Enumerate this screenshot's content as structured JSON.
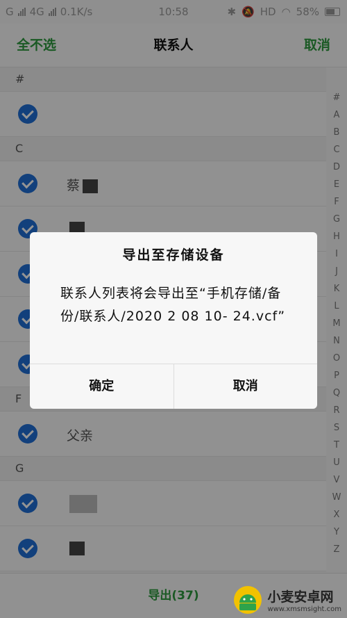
{
  "status_bar": {
    "carrier": "G",
    "network": "4G",
    "speed": "0.1K/s",
    "time": "10:58",
    "hd": "HD",
    "battery": "58%"
  },
  "app_bar": {
    "select_none": "全不选",
    "title": "联系人",
    "cancel": "取消"
  },
  "contacts": {
    "sections": [
      {
        "letter": "#",
        "rows": [
          {
            "name": ""
          }
        ]
      },
      {
        "letter": "C",
        "rows": [
          {
            "name": "蔡"
          },
          {
            "name": ""
          },
          {
            "name": ""
          },
          {
            "name": ""
          },
          {
            "name": ""
          }
        ]
      },
      {
        "letter": "F",
        "rows": [
          {
            "name": "父亲"
          }
        ]
      },
      {
        "letter": "G",
        "rows": [
          {
            "name": ""
          },
          {
            "name": ""
          }
        ]
      }
    ]
  },
  "alphabet_index": [
    "#",
    "A",
    "B",
    "C",
    "D",
    "E",
    "F",
    "G",
    "H",
    "I",
    "J",
    "K",
    "L",
    "M",
    "N",
    "O",
    "P",
    "Q",
    "R",
    "S",
    "T",
    "U",
    "V",
    "W",
    "X",
    "Y",
    "Z"
  ],
  "bottom_bar": {
    "export_label": "导出(37)"
  },
  "dialog": {
    "title": "导出至存储设备",
    "message": "联系人列表将会导出至“手机存储/备份/联系人/2020 2 08 10- 24.vcf”",
    "confirm": "确定",
    "cancel": "取消"
  },
  "watermark": {
    "name": "小麦安卓网",
    "url": "www.xmsmsight.com"
  },
  "colors": {
    "accent_green": "#2e9a3e",
    "check_blue": "#1f6fd6"
  }
}
